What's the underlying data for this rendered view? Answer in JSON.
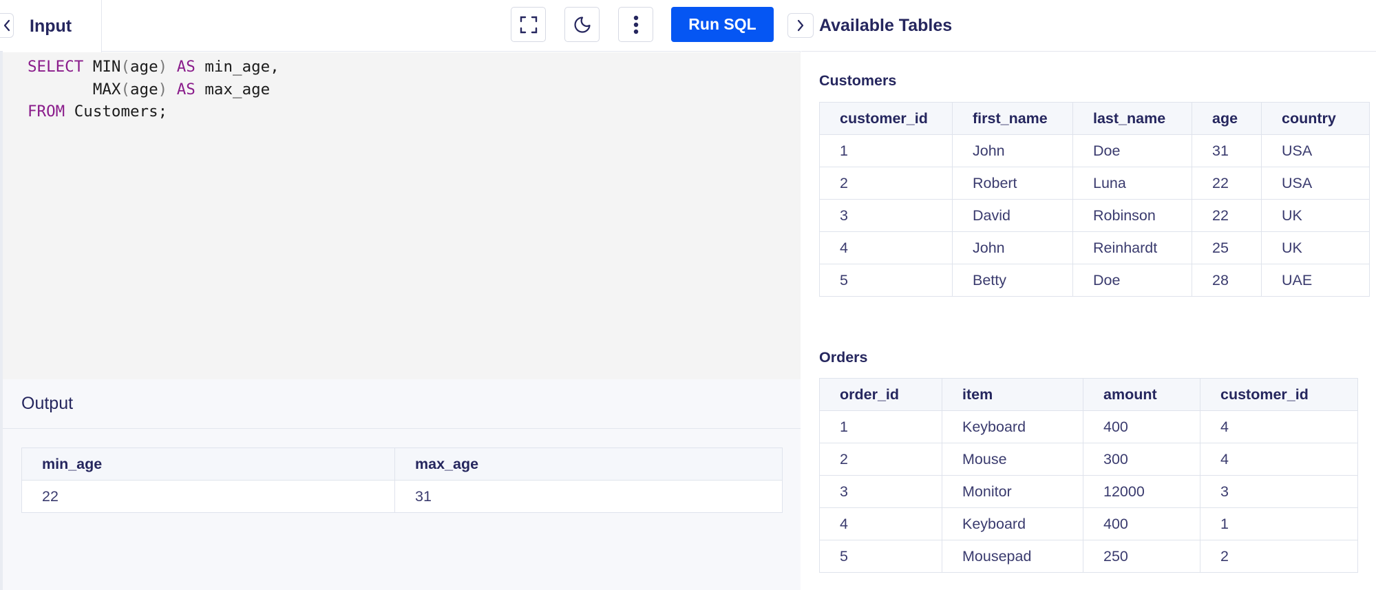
{
  "editor": {
    "tab_label": "Input",
    "run_label": "Run SQL",
    "line1": {
      "kw1": "SELECT",
      "fn": " MIN",
      "p1": "(",
      "arg": "age",
      "p2": ")",
      "kw2": " AS",
      "rest": " min_age,"
    },
    "line2": {
      "indent": "       ",
      "fn": "MAX",
      "p1": "(",
      "arg": "age",
      "p2": ")",
      "kw2": " AS",
      "rest": " max_age"
    },
    "line3": {
      "kw1": "FROM",
      "rest": " Customers;"
    }
  },
  "output": {
    "title": "Output",
    "columns": [
      "min_age",
      "max_age"
    ],
    "rows": [
      [
        "22",
        "31"
      ]
    ]
  },
  "tables_panel": {
    "title": "Available Tables",
    "customers": {
      "title": "Customers",
      "columns": [
        "customer_id",
        "first_name",
        "last_name",
        "age",
        "country"
      ],
      "rows": [
        [
          "1",
          "John",
          "Doe",
          "31",
          "USA"
        ],
        [
          "2",
          "Robert",
          "Luna",
          "22",
          "USA"
        ],
        [
          "3",
          "David",
          "Robinson",
          "22",
          "UK"
        ],
        [
          "4",
          "John",
          "Reinhardt",
          "25",
          "UK"
        ],
        [
          "5",
          "Betty",
          "Doe",
          "28",
          "UAE"
        ]
      ]
    },
    "orders": {
      "title": "Orders",
      "columns": [
        "order_id",
        "item",
        "amount",
        "customer_id"
      ],
      "rows": [
        [
          "1",
          "Keyboard",
          "400",
          "4"
        ],
        [
          "2",
          "Mouse",
          "300",
          "4"
        ],
        [
          "3",
          "Monitor",
          "12000",
          "3"
        ],
        [
          "4",
          "Keyboard",
          "400",
          "1"
        ],
        [
          "5",
          "Mousepad",
          "250",
          "2"
        ]
      ]
    }
  },
  "icons": {
    "collapse_left": "chevron-left-icon",
    "collapse_right": "chevron-right-icon",
    "fullscreen": "fullscreen-icon",
    "theme": "moon-icon",
    "more": "more-vertical-icon"
  },
  "colors": {
    "accent": "#0556f3",
    "keyword": "#8a1c8b",
    "text": "#25265e"
  }
}
